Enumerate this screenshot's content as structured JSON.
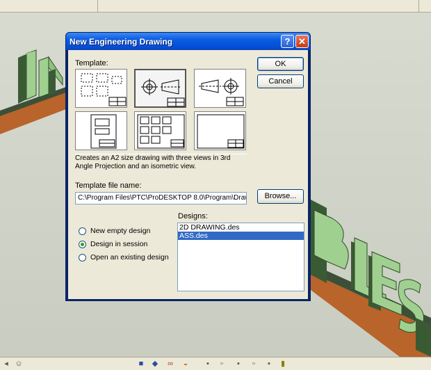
{
  "dialog": {
    "title": "New Engineering Drawing",
    "help_icon": "?",
    "close_icon": "✕",
    "template_label": "Template:",
    "templates": [
      {
        "name": "layout-rectangles",
        "selected": false
      },
      {
        "name": "three-views-a2",
        "selected": true
      },
      {
        "name": "three-views-reverse",
        "selected": false
      },
      {
        "name": "single-column",
        "selected": false
      },
      {
        "name": "grid-views",
        "selected": false
      },
      {
        "name": "blank",
        "selected": false
      }
    ],
    "description": "Creates an A2 size drawing with three views in 3rd Angle Projection and an isometric view.",
    "template_file_label": "Template file name:",
    "template_file_value": "C:\\Program Files\\PTC\\ProDESKTOP 8.0\\Program\\Drawi",
    "ok_label": "OK",
    "cancel_label": "Cancel",
    "browse_label": "Browse...",
    "designs_label": "Designs:",
    "radio_options": [
      {
        "label": "New empty design",
        "checked": false
      },
      {
        "label": "Design in session",
        "checked": true
      },
      {
        "label": "Open an existing design",
        "checked": false
      }
    ],
    "designs": [
      {
        "name": "2D DRAWING.des",
        "selected": false
      },
      {
        "name": "ASS.des",
        "selected": true
      }
    ]
  },
  "colors": {
    "titlebar": "#0553dc",
    "selection": "#316ac5",
    "dialog_bg": "#ece9d8",
    "letters": "#8fbf7f",
    "base": "#b8642a"
  }
}
